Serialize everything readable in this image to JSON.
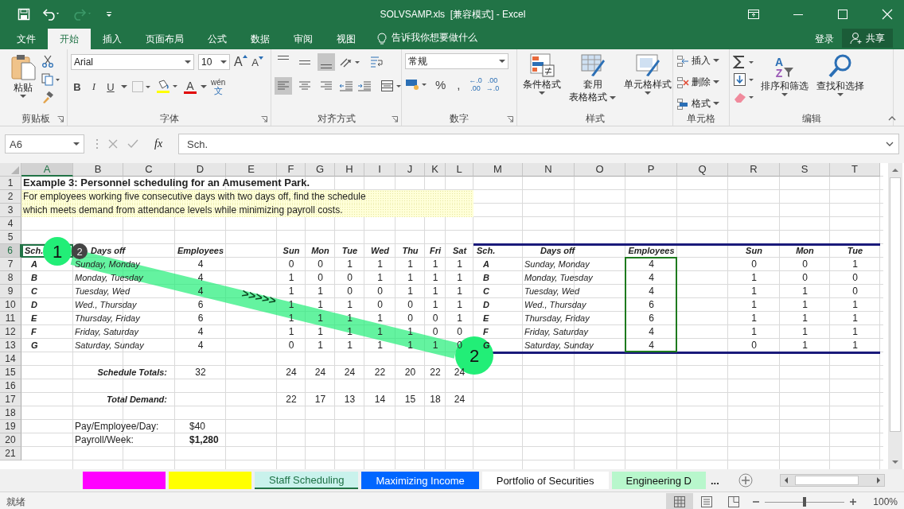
{
  "title_bar": {
    "title": "SOLVSAMP.xls  [兼容模式] - Excel"
  },
  "menu": {
    "tabs": [
      {
        "label": "文件",
        "selected": false
      },
      {
        "label": "开始",
        "selected": true
      },
      {
        "label": "插入",
        "selected": false
      },
      {
        "label": "页面布局",
        "selected": false
      },
      {
        "label": "公式",
        "selected": false
      },
      {
        "label": "数据",
        "selected": false
      },
      {
        "label": "审阅",
        "selected": false
      },
      {
        "label": "视图",
        "selected": false
      }
    ],
    "tell_me": "告诉我你想要做什么",
    "sign_in": "登录",
    "share": "共享"
  },
  "ribbon": {
    "clipboard": {
      "paste": "粘贴",
      "label": "剪贴板"
    },
    "font": {
      "name": "Arial",
      "size": "10",
      "grow": "A",
      "shrink": "A",
      "bold": "B",
      "italic": "I",
      "underline": "U",
      "color_letter": "A",
      "phonetic_top": "wén",
      "phonetic_bottom": "文",
      "label": "字体"
    },
    "alignment": {
      "vertical": [
        {
          "selected": false
        },
        {
          "selected": false
        },
        {
          "selected": true
        }
      ],
      "horizontal": [
        {
          "selected": true
        },
        {
          "selected": false
        },
        {
          "selected": false
        }
      ],
      "label": "对齐方式"
    },
    "number": {
      "format": "常规",
      "percent": "%",
      "comma": ",",
      "inc_decimal": [
        "←.0",
        ".00"
      ],
      "dec_decimal": [
        ".00",
        "→.0"
      ],
      "label": "数字"
    },
    "styles": {
      "conditional": "条件格式",
      "table_top": "套用",
      "table_bottom": "表格格式",
      "cell_styles": "单元格样式",
      "label": "样式"
    },
    "cells": {
      "items": [
        "插入",
        "删除",
        "格式"
      ],
      "label": "单元格"
    },
    "editing": {
      "sort_letters": [
        "A",
        "Z"
      ],
      "sort": "排序和筛选",
      "find": "查找和选择",
      "label": "编辑"
    }
  },
  "formula_bar": {
    "name_box": "A6",
    "fx": "fx",
    "formula": "Sch."
  },
  "sheet": {
    "columns": [
      {
        "label": "A",
        "selected": true
      },
      {
        "label": "B",
        "selected": false
      },
      {
        "label": "C",
        "selected": false
      },
      {
        "label": "D",
        "selected": false
      },
      {
        "label": "E",
        "selected": false
      },
      {
        "label": "F",
        "selected": false
      },
      {
        "label": "G",
        "selected": false
      },
      {
        "label": "H",
        "selected": false
      },
      {
        "label": "I",
        "selected": false
      },
      {
        "label": "J",
        "selected": false
      },
      {
        "label": "K",
        "selected": false
      },
      {
        "label": "L",
        "selected": false
      },
      {
        "label": "M",
        "selected": false
      },
      {
        "label": "N",
        "selected": false
      },
      {
        "label": "O",
        "selected": false
      },
      {
        "label": "P",
        "selected": false
      },
      {
        "label": "Q",
        "selected": false
      },
      {
        "label": "R",
        "selected": false
      },
      {
        "label": "S",
        "selected": false
      },
      {
        "label": "T",
        "selected": false
      }
    ],
    "rows": [
      {
        "label": "1",
        "selected": false
      },
      {
        "label": "2",
        "selected": false
      },
      {
        "label": "3",
        "selected": false
      },
      {
        "label": "4",
        "selected": false
      },
      {
        "label": "5",
        "selected": false
      },
      {
        "label": "6",
        "selected": true
      },
      {
        "label": "7",
        "selected": false
      },
      {
        "label": "8",
        "selected": false
      },
      {
        "label": "9",
        "selected": false
      },
      {
        "label": "10",
        "selected": false
      },
      {
        "label": "11",
        "selected": false
      },
      {
        "label": "12",
        "selected": false
      },
      {
        "label": "13",
        "selected": false
      },
      {
        "label": "14",
        "selected": false
      },
      {
        "label": "15",
        "selected": false
      },
      {
        "label": "16",
        "selected": false
      },
      {
        "label": "17",
        "selected": false
      },
      {
        "label": "18",
        "selected": false
      },
      {
        "label": "19",
        "selected": false
      },
      {
        "label": "20",
        "selected": false
      },
      {
        "label": "21",
        "selected": false
      }
    ],
    "title": "Example 3:  Personnel scheduling for an Amusement Park.",
    "description": [
      "For employees working five consecutive days with two days off, find the schedule",
      "which meets demand from attendance levels while minimizing payroll costs."
    ],
    "left_table": {
      "header_selected": true,
      "headers": {
        "sch": "Sch.",
        "days_off": "Days off",
        "employees": "Employees",
        "days": [
          "Sun",
          "Mon",
          "Tue",
          "Wed",
          "Thu",
          "Fri",
          "Sat"
        ]
      },
      "rows": [
        {
          "sch": "A",
          "days_off": "Sunday, Monday",
          "employees": "4",
          "days": [
            "0",
            "0",
            "1",
            "1",
            "1",
            "1",
            "1"
          ]
        },
        {
          "sch": "B",
          "days_off": "Monday, Tuesday",
          "employees": "4",
          "days": [
            "1",
            "0",
            "0",
            "1",
            "1",
            "1",
            "1"
          ]
        },
        {
          "sch": "C",
          "days_off": "Tuesday, Wed",
          "employees": "4",
          "days": [
            "1",
            "1",
            "0",
            "0",
            "1",
            "1",
            "1"
          ]
        },
        {
          "sch": "D",
          "days_off": "Wed., Thursday",
          "employees": "6",
          "days": [
            "1",
            "1",
            "1",
            "0",
            "0",
            "1",
            "1"
          ]
        },
        {
          "sch": "E",
          "days_off": "Thursday, Friday",
          "employees": "6",
          "days": [
            "1",
            "1",
            "1",
            "1",
            "0",
            "0",
            "1"
          ]
        },
        {
          "sch": "F",
          "days_off": "Friday, Saturday",
          "employees": "4",
          "days": [
            "1",
            "1",
            "1",
            "1",
            "1",
            "0",
            "0"
          ]
        },
        {
          "sch": "G",
          "days_off": "Saturday, Sunday",
          "employees": "4",
          "days": [
            "0",
            "1",
            "1",
            "1",
            "1",
            "1",
            "0"
          ]
        }
      ],
      "totals_label": "Schedule Totals:",
      "totals_employees": "32",
      "totals_days": [
        "24",
        "24",
        "24",
        "22",
        "20",
        "22",
        "24"
      ],
      "demand_label": "Total Demand:",
      "demand_days": [
        "22",
        "17",
        "13",
        "14",
        "15",
        "18",
        "24"
      ],
      "pay_label": "Pay/Employee/Day:",
      "pay_value": "$40",
      "payroll_label": "Payroll/Week:",
      "payroll_value": "$1,280"
    },
    "right_table": {
      "headers": {
        "sch": "Sch.",
        "days_off": "Days off",
        "employees": "Employees",
        "days": [
          "Sun",
          "Mon",
          "Tue"
        ]
      },
      "rows": [
        {
          "sch": "A",
          "days_off": "Sunday, Monday",
          "employees": "4",
          "days": [
            "0",
            "0",
            "1"
          ]
        },
        {
          "sch": "B",
          "days_off": "Monday, Tuesday",
          "employees": "4",
          "days": [
            "1",
            "0",
            "0"
          ]
        },
        {
          "sch": "C",
          "days_off": "Tuesday, Wed",
          "employees": "4",
          "days": [
            "1",
            "1",
            "0"
          ]
        },
        {
          "sch": "D",
          "days_off": "Wed., Thursday",
          "employees": "6",
          "days": [
            "1",
            "1",
            "1"
          ]
        },
        {
          "sch": "E",
          "days_off": "Thursday, Friday",
          "employees": "6",
          "days": [
            "1",
            "1",
            "1"
          ]
        },
        {
          "sch": "F",
          "days_off": "Friday, Saturday",
          "employees": "4",
          "days": [
            "1",
            "1",
            "1"
          ]
        },
        {
          "sch": "G",
          "days_off": "Saturday, Sunday",
          "employees": "4",
          "days": [
            "0",
            "1",
            "1"
          ]
        }
      ]
    }
  },
  "annotation": {
    "markers": [
      {
        "kind": "start",
        "label": "1"
      },
      {
        "kind": "step",
        "label": "2"
      },
      {
        "kind": "end",
        "label": "2"
      }
    ],
    "arrows": ">>>>>"
  },
  "sheet_tabs": [
    {
      "color": "#ff00ff",
      "selected": false
    },
    {
      "color": "#ffff00",
      "selected": false
    },
    {
      "label": "Staff Scheduling",
      "color": "#c9f2ec",
      "selected": true
    },
    {
      "label": "Maximizing Income",
      "color": "#0066ff",
      "selected": false
    },
    {
      "label": "Portfolio of Securities",
      "color": "#ffffff",
      "selected": false
    },
    {
      "label": "Engineering D",
      "color": "#b8f7cc",
      "selected": false
    }
  ],
  "more_tabs": "...",
  "status_bar": {
    "status": "就绪",
    "views": [
      {
        "selected": true
      },
      {
        "selected": false
      },
      {
        "selected": false
      }
    ],
    "zoom_slider": {
      "level": 0.5
    },
    "zoom": "100%"
  }
}
